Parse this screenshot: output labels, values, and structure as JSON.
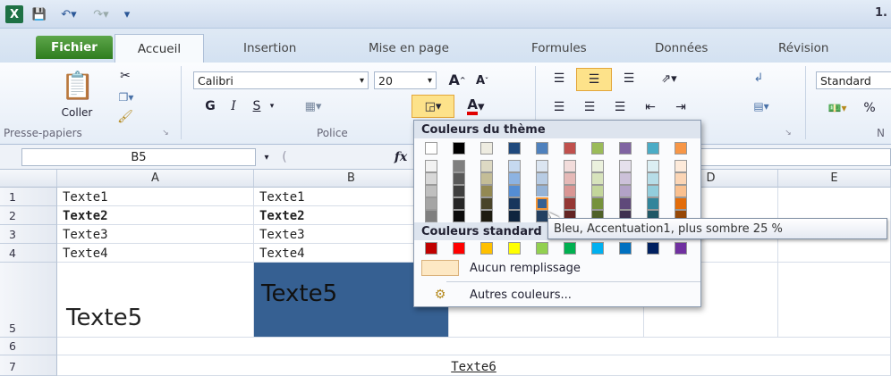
{
  "titlebar": {
    "app_title": "1."
  },
  "tabs": [
    "Fichier",
    "Accueil",
    "Insertion",
    "Mise en page",
    "Formules",
    "Données",
    "Révision"
  ],
  "ribbon": {
    "paste_label": "Coller",
    "font_name": "Calibri",
    "font_size": "20",
    "bold": "G",
    "italic": "I",
    "underline": "S",
    "number_format": "Standard",
    "groups": {
      "clipboard": "Presse-papiers",
      "font": "Police",
      "number": "N"
    }
  },
  "formula_bar": {
    "name_box": "B5",
    "fx": "fx"
  },
  "columns": [
    "A",
    "B",
    "C",
    "D",
    "E"
  ],
  "rows": [
    "1",
    "2",
    "3",
    "4",
    "5",
    "6",
    "7"
  ],
  "cells": {
    "A1": "Texte1",
    "B1": "Texte1",
    "A2": "Texte2",
    "B2": "Texte2",
    "A3": "Texte3",
    "B3": "Texte3",
    "A4": "Texte4",
    "B4": "Texte4",
    "A5": "Texte5",
    "B5": "Texte5",
    "B7": "Texte6"
  },
  "palette": {
    "theme_header": "Couleurs du thème",
    "standard_header": "Couleurs standard",
    "no_fill": "Aucun remplissage",
    "more_colors": "Autres couleurs...",
    "theme_top": [
      "#ffffff",
      "#000000",
      "#eeece1",
      "#1f497d",
      "#4f81bd",
      "#c0504d",
      "#9bbb59",
      "#8064a2",
      "#4bacc6",
      "#f79646"
    ],
    "theme_shades": [
      [
        "#f2f2f2",
        "#7f7f7f",
        "#ddd9c3",
        "#c6d9f0",
        "#dbe5f1",
        "#f2dcdb",
        "#ebf1dd",
        "#e5e0ec",
        "#dbeef3",
        "#fdeada"
      ],
      [
        "#d8d8d8",
        "#595959",
        "#c4bd97",
        "#8db3e2",
        "#b8cce4",
        "#e5b9b7",
        "#d7e3bc",
        "#ccc1d9",
        "#b7dde8",
        "#fbd5b5"
      ],
      [
        "#bfbfbf",
        "#3f3f3f",
        "#938953",
        "#548dd4",
        "#95b3d7",
        "#d99694",
        "#c3d69b",
        "#b2a2c7",
        "#92cddc",
        "#fac08f"
      ],
      [
        "#a5a5a5",
        "#262626",
        "#494429",
        "#17365d",
        "#366092",
        "#953734",
        "#76923c",
        "#5f497a",
        "#31859b",
        "#e36c09"
      ],
      [
        "#7f7f7f",
        "#0c0c0c",
        "#1d1b10",
        "#0f243e",
        "#244061",
        "#632423",
        "#4f6128",
        "#3f3151",
        "#205867",
        "#974806"
      ]
    ],
    "standard": [
      "#c00000",
      "#ff0000",
      "#ffc000",
      "#ffff00",
      "#92d050",
      "#00b050",
      "#00b0f0",
      "#0070c0",
      "#002060",
      "#7030a0"
    ],
    "tooltip": "Bleu, Accentuation1, plus sombre 25 %"
  },
  "colors": {
    "selected_fill": "#366092",
    "file_tab": "#3a8a2a"
  }
}
